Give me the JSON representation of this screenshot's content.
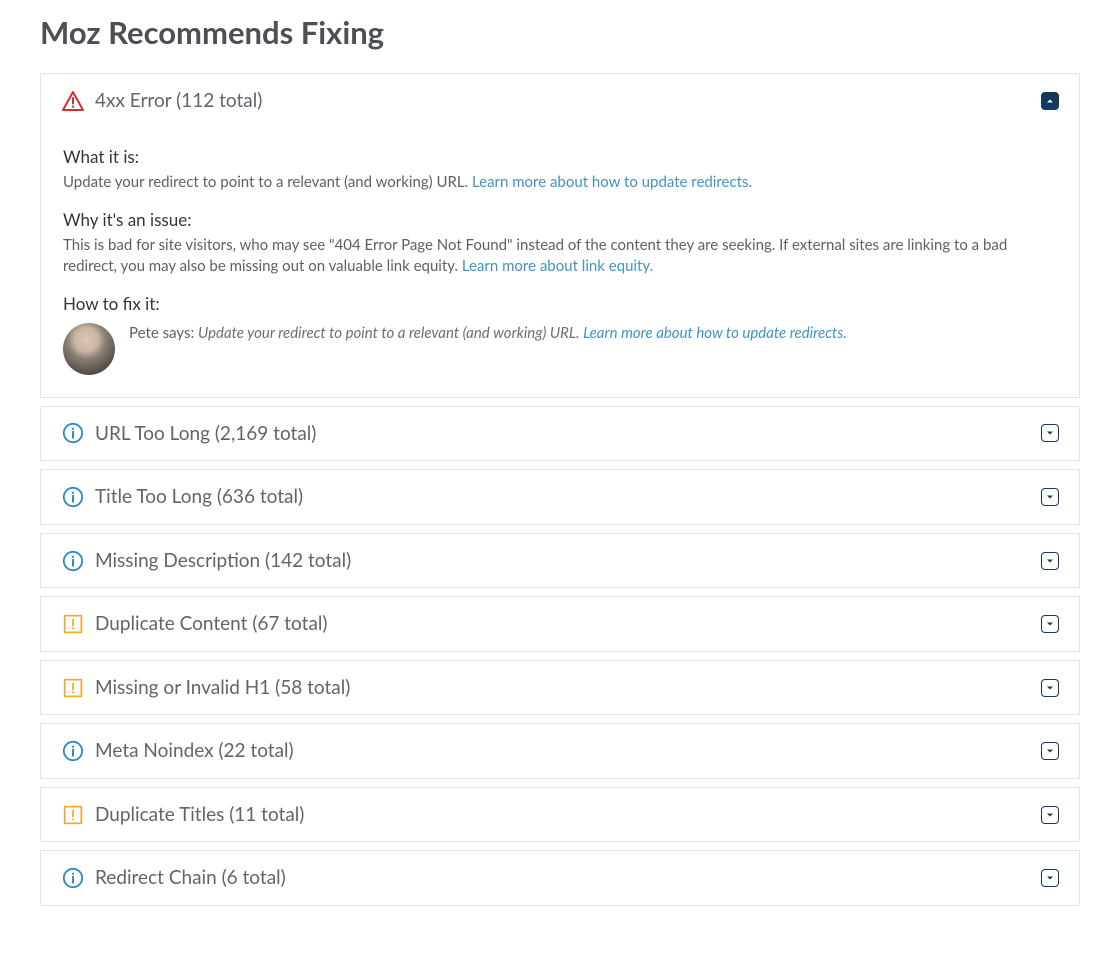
{
  "page": {
    "title": "Moz Recommends Fixing"
  },
  "detail": {
    "what_heading": "What it is:",
    "what_text": "Update your redirect to point to a relevant (and working) URL. ",
    "what_link": "Learn more about how to update redirects.",
    "why_heading": "Why it's an issue:",
    "why_text": "This is bad for site visitors, who may see \"404 Error Page Not Found\" instead of the content they are seeking. If external sites are linking to a bad redirect, you may also be missing out on valuable link equity. ",
    "why_link": "Learn more about link equity.",
    "fix_heading": "How to fix it:",
    "fix_says": "Pete says: ",
    "fix_text": "Update your redirect to point to a relevant (and working) URL. ",
    "fix_link": "Learn more about how to update redirects."
  },
  "issues": [
    {
      "id": "4xx-error",
      "icon": "alert-triangle",
      "label": "4xx Error (112 total)",
      "expanded": true
    },
    {
      "id": "url-too-long",
      "icon": "info",
      "label": "URL Too Long (2,169 total)",
      "expanded": false
    },
    {
      "id": "title-too-long",
      "icon": "info",
      "label": "Title Too Long (636 total)",
      "expanded": false
    },
    {
      "id": "missing-description",
      "icon": "info",
      "label": "Missing Description (142 total)",
      "expanded": false
    },
    {
      "id": "duplicate-content",
      "icon": "warn-square",
      "label": "Duplicate Content (67 total)",
      "expanded": false
    },
    {
      "id": "missing-h1",
      "icon": "warn-square",
      "label": "Missing or Invalid H1 (58 total)",
      "expanded": false
    },
    {
      "id": "meta-noindex",
      "icon": "info",
      "label": "Meta Noindex (22 total)",
      "expanded": false
    },
    {
      "id": "duplicate-titles",
      "icon": "warn-square",
      "label": "Duplicate Titles (11 total)",
      "expanded": false
    },
    {
      "id": "redirect-chain",
      "icon": "info",
      "label": "Redirect Chain (6 total)",
      "expanded": false
    }
  ]
}
